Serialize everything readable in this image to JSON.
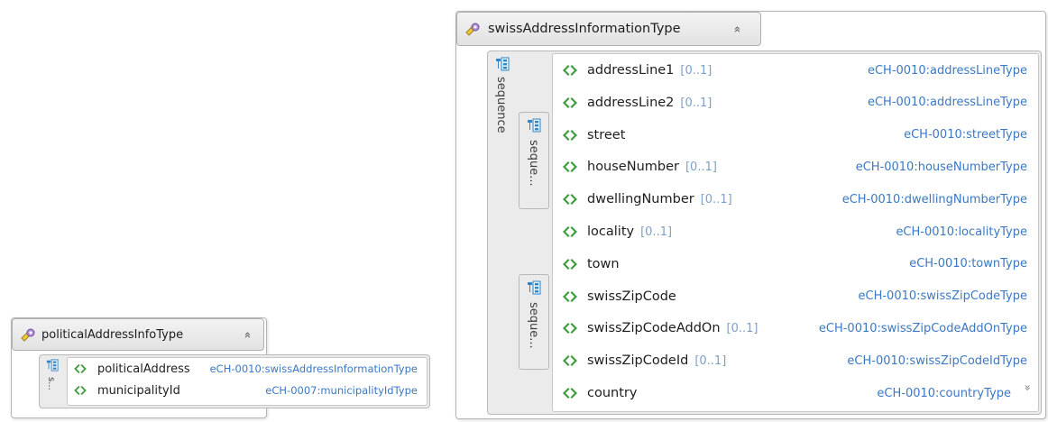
{
  "swiss": {
    "type_name": "swissAddressInformationType",
    "collapse_glyph": "«",
    "sequence_label": "sequence",
    "sub_sequence_label_1": "seque...",
    "sub_sequence_label_2": "seque...",
    "expand_glyph": "»",
    "elements": [
      {
        "name": "addressLine1",
        "occurrence": "[0..1]",
        "type": "eCH-0010:addressLineType"
      },
      {
        "name": "addressLine2",
        "occurrence": "[0..1]",
        "type": "eCH-0010:addressLineType"
      },
      {
        "name": "street",
        "occurrence": "",
        "type": "eCH-0010:streetType"
      },
      {
        "name": "houseNumber",
        "occurrence": "[0..1]",
        "type": "eCH-0010:houseNumberType"
      },
      {
        "name": "dwellingNumber",
        "occurrence": "[0..1]",
        "type": "eCH-0010:dwellingNumberType"
      },
      {
        "name": "locality",
        "occurrence": "[0..1]",
        "type": "eCH-0010:localityType"
      },
      {
        "name": "town",
        "occurrence": "",
        "type": "eCH-0010:townType"
      },
      {
        "name": "swissZipCode",
        "occurrence": "",
        "type": "eCH-0010:swissZipCodeType"
      },
      {
        "name": "swissZipCodeAddOn",
        "occurrence": "[0..1]",
        "type": "eCH-0010:swissZipCodeAddOnType"
      },
      {
        "name": "swissZipCodeId",
        "occurrence": "[0..1]",
        "type": "eCH-0010:swissZipCodeIdType"
      },
      {
        "name": "country",
        "occurrence": "",
        "type": "eCH-0010:countryType"
      }
    ]
  },
  "political": {
    "type_name": "politicalAddressInfoType",
    "collapse_glyph": "«",
    "sequence_label": "s...",
    "elements": [
      {
        "name": "politicalAddress",
        "type": "eCH-0010:swissAddressInformationType"
      },
      {
        "name": "municipalityId",
        "type": "eCH-0007:municipalityIdType"
      }
    ]
  },
  "icons": {
    "type": "complex-type-icon",
    "sequence": "sequence-icon",
    "element": "element-icon"
  },
  "colors": {
    "type_link": "#3c78c3",
    "occurrence": "#7fa0c8",
    "element_icon": "#3c9c3c",
    "sequence_icon": "#2f86c8"
  }
}
